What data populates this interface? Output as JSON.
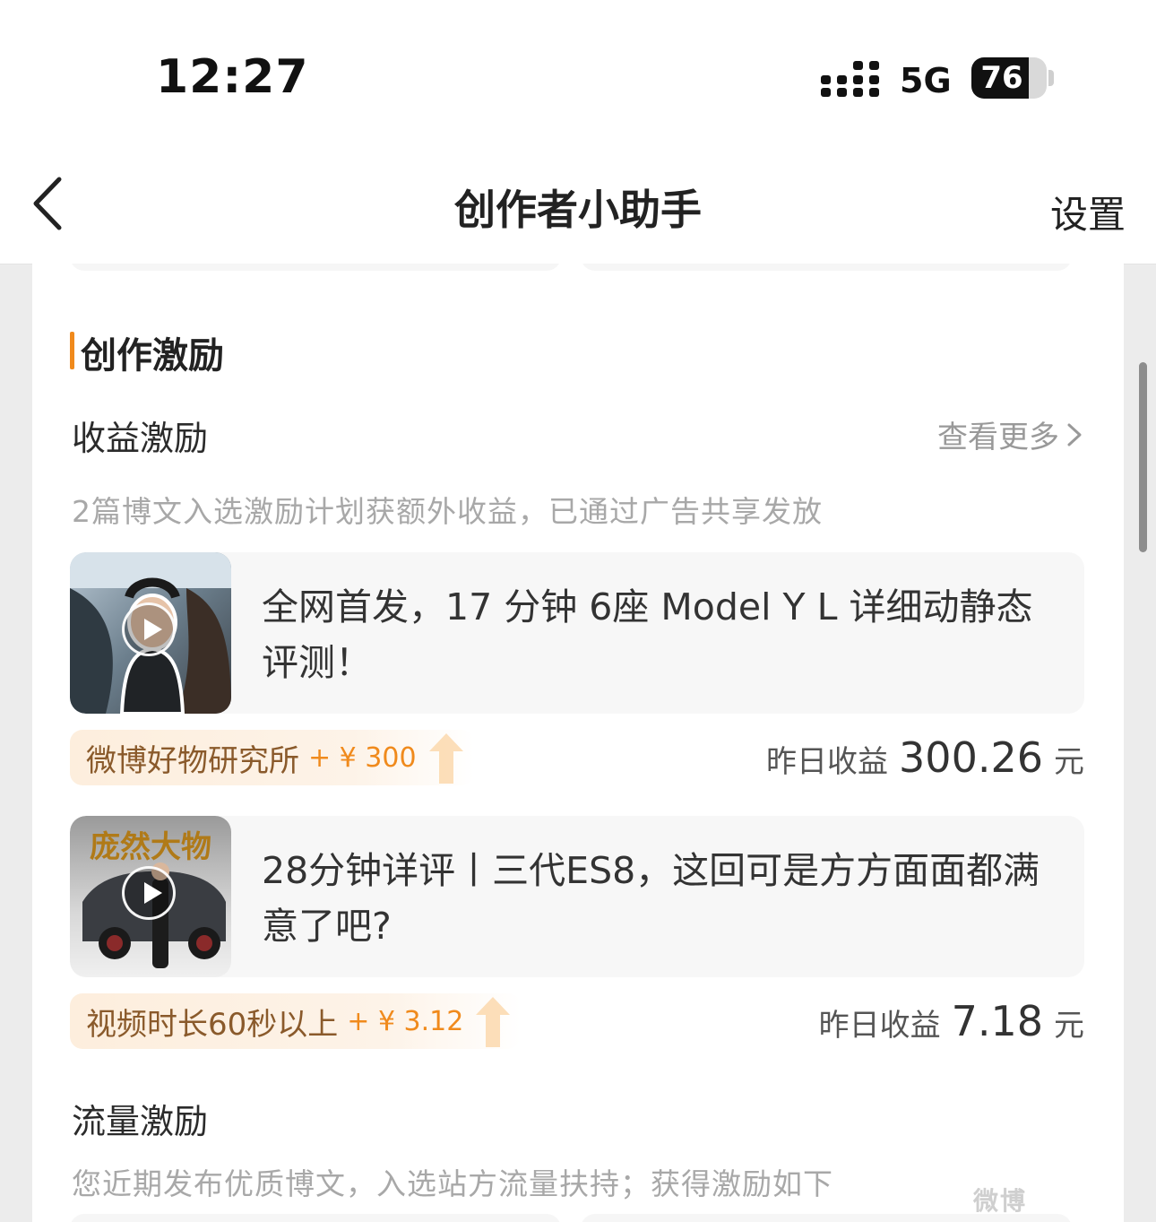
{
  "status_bar": {
    "time": "12:27",
    "network": "5G",
    "battery": "76",
    "battery_level": 0.76
  },
  "nav": {
    "title": "创作者小助手",
    "settings_label": "设置"
  },
  "section": {
    "title": "创作激励",
    "income": {
      "title": "收益激励",
      "more_label": "查看更多",
      "description": "2篇博文入选激励计划获额外收益，已通过广告共享发放",
      "posts": [
        {
          "title": "全网首发，17 分钟 6座 Model Y L 详细动静态评测！",
          "tag_name": "微博好物研究所",
          "tag_bonus": "+ ¥ 300",
          "earnings_label": "昨日收益",
          "earnings_value": "300.26",
          "earnings_unit": "元"
        },
        {
          "title": "28分钟详评丨三代ES8，这回可是方方面面都满意了吧?",
          "thumbnail_text": "庞然大物",
          "tag_name": "视频时长60秒以上",
          "tag_bonus": "+ ¥ 3.12",
          "earnings_label": "昨日收益",
          "earnings_value": "7.18",
          "earnings_unit": "元"
        }
      ]
    },
    "traffic": {
      "title": "流量激励",
      "description": "您近期发布优质博文，入选站方流量扶持；获得激励如下"
    }
  },
  "watermark": "微博"
}
